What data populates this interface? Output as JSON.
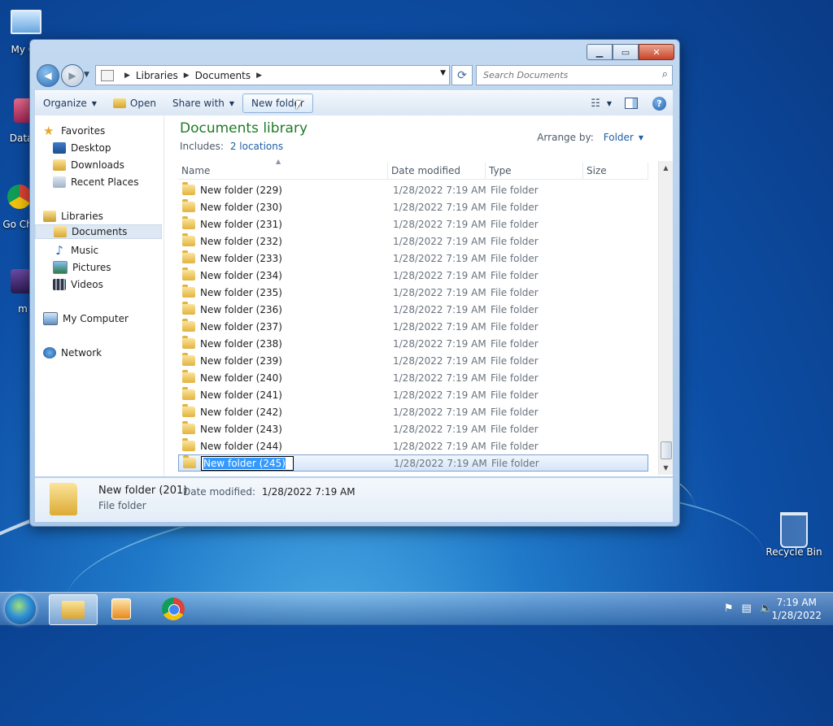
{
  "desktop": {
    "icons": [
      {
        "label": "My Co"
      },
      {
        "label": "DataW"
      },
      {
        "label": "Go Chr"
      },
      {
        "label": "m"
      },
      {
        "label": "Recycle Bin"
      }
    ]
  },
  "window": {
    "address": {
      "crumbs": [
        "Libraries",
        "Documents"
      ]
    },
    "search": {
      "placeholder": "Search Documents"
    },
    "toolbar": {
      "organize": "Organize",
      "open": "Open",
      "share_with": "Share with",
      "new_folder": "New folder"
    },
    "sidebar": {
      "favorites": "Favorites",
      "desktop": "Desktop",
      "downloads": "Downloads",
      "recent_places": "Recent Places",
      "libraries": "Libraries",
      "documents": "Documents",
      "music": "Music",
      "pictures": "Pictures",
      "videos": "Videos",
      "my_computer": "My Computer",
      "network": "Network"
    },
    "library": {
      "title": "Documents library",
      "includes_label": "Includes:",
      "locations_link": "2 locations",
      "arrange_label": "Arrange by:",
      "arrange_value": "Folder"
    },
    "columns": {
      "name": "Name",
      "date": "Date modified",
      "type": "Type",
      "size": "Size"
    },
    "rows": [
      {
        "name": "New folder (229)",
        "date": "1/28/2022 7:19 AM",
        "type": "File folder"
      },
      {
        "name": "New folder (230)",
        "date": "1/28/2022 7:19 AM",
        "type": "File folder"
      },
      {
        "name": "New folder (231)",
        "date": "1/28/2022 7:19 AM",
        "type": "File folder"
      },
      {
        "name": "New folder (232)",
        "date": "1/28/2022 7:19 AM",
        "type": "File folder"
      },
      {
        "name": "New folder (233)",
        "date": "1/28/2022 7:19 AM",
        "type": "File folder"
      },
      {
        "name": "New folder (234)",
        "date": "1/28/2022 7:19 AM",
        "type": "File folder"
      },
      {
        "name": "New folder (235)",
        "date": "1/28/2022 7:19 AM",
        "type": "File folder"
      },
      {
        "name": "New folder (236)",
        "date": "1/28/2022 7:19 AM",
        "type": "File folder"
      },
      {
        "name": "New folder (237)",
        "date": "1/28/2022 7:19 AM",
        "type": "File folder"
      },
      {
        "name": "New folder (238)",
        "date": "1/28/2022 7:19 AM",
        "type": "File folder"
      },
      {
        "name": "New folder (239)",
        "date": "1/28/2022 7:19 AM",
        "type": "File folder"
      },
      {
        "name": "New folder (240)",
        "date": "1/28/2022 7:19 AM",
        "type": "File folder"
      },
      {
        "name": "New folder (241)",
        "date": "1/28/2022 7:19 AM",
        "type": "File folder"
      },
      {
        "name": "New folder (242)",
        "date": "1/28/2022 7:19 AM",
        "type": "File folder"
      },
      {
        "name": "New folder (243)",
        "date": "1/28/2022 7:19 AM",
        "type": "File folder"
      },
      {
        "name": "New folder (244)",
        "date": "1/28/2022 7:19 AM",
        "type": "File folder"
      }
    ],
    "renaming_row": {
      "name": "New folder (245)",
      "date": "1/28/2022 7:19 AM",
      "type": "File folder"
    },
    "details": {
      "name": "New folder (201)",
      "modified_label": "Date modified:",
      "modified_value": "1/28/2022 7:19 AM",
      "type": "File folder"
    }
  },
  "taskbar": {
    "clock_time": "7:19 AM",
    "clock_date": "1/28/2022"
  },
  "colors": {
    "library_title": "#1e7a28",
    "link": "#1f5ea8"
  }
}
